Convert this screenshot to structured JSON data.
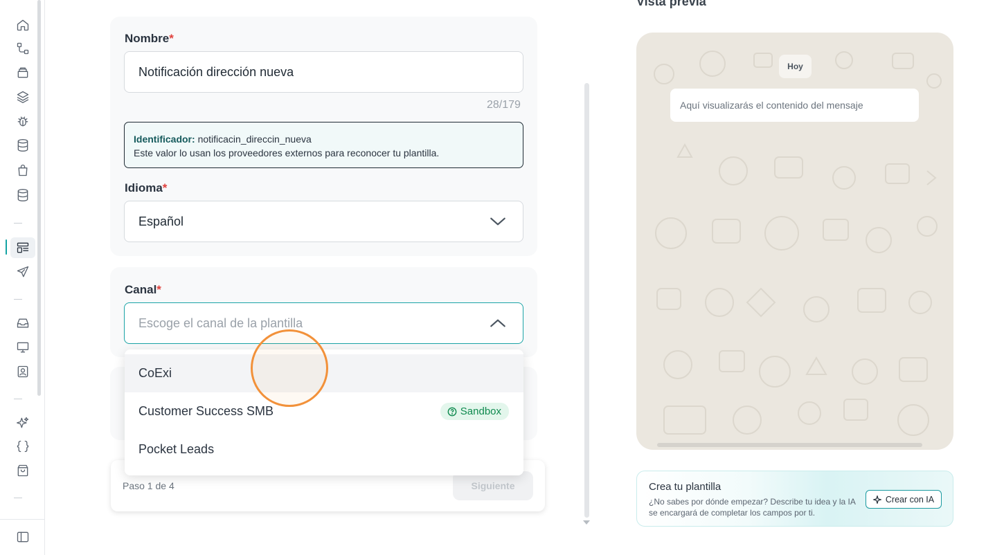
{
  "form": {
    "name": {
      "label": "Nombre",
      "required_mark": "*",
      "value": "Notificación dirección nueva",
      "counter": "28/179"
    },
    "identifier": {
      "label": "Identificador:",
      "value": "notificacin_direccin_nueva",
      "help": "Este valor lo usan los proveedores externos para reconocer tu plantilla."
    },
    "language": {
      "label": "Idioma",
      "required_mark": "*",
      "value": "Español"
    },
    "channel": {
      "label": "Canal",
      "required_mark": "*",
      "placeholder": "Escoge el canal de la plantilla",
      "options": [
        {
          "label": "CoExi"
        },
        {
          "label": "Customer Success SMB",
          "badge": "Sandbox"
        },
        {
          "label": "Pocket Leads"
        }
      ]
    }
  },
  "footer": {
    "step": "Paso 1 de 4",
    "next_label": "Siguiente"
  },
  "preview": {
    "title": "Vista previa",
    "date_chip": "Hoy",
    "message_placeholder": "Aquí visualizarás el contenido del mensaje"
  },
  "ai_card": {
    "title": "Crea tu plantilla",
    "description": "¿No sabes por dónde empezar? Describe tu idea y la IA se encargará de completar los campos por ti.",
    "button_label": "Crear con IA"
  },
  "sidebar": {
    "icons": [
      "home-icon",
      "workflow-icon",
      "archive-icon",
      "layers-icon",
      "bug-icon",
      "database-icon",
      "bag-icon",
      "database-stack-icon",
      "templates-icon",
      "send-icon",
      "inbox-icon",
      "monitor-icon",
      "contact-card-icon",
      "sparkles-icon",
      "braces-icon",
      "shopping-bag-icon",
      "sidebar-toggle-icon"
    ]
  },
  "colors": {
    "accent": "#12a3a3",
    "required": "#e0413d",
    "badge_green": "#0f8a4f",
    "click_ring": "#f2913a"
  }
}
